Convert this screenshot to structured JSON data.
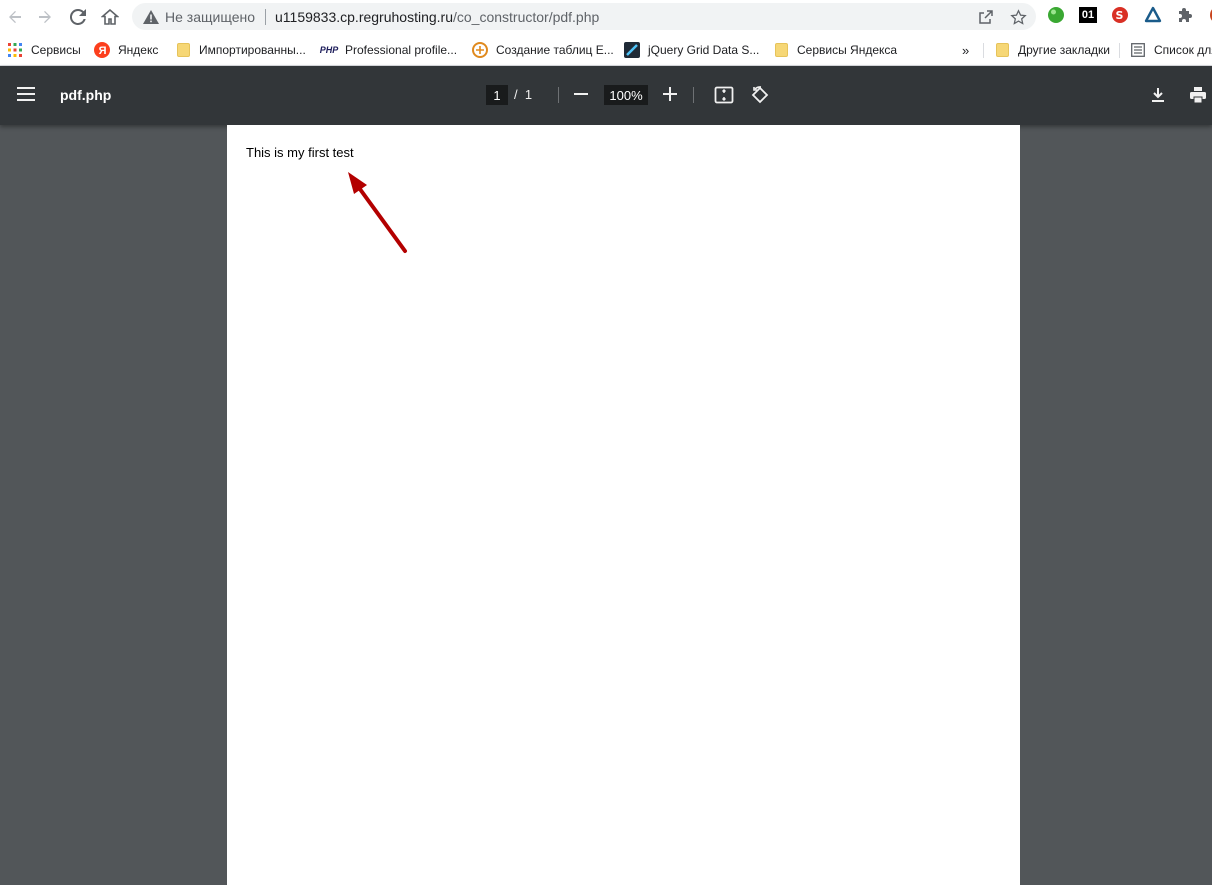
{
  "browser": {
    "security_label": "Не защищено",
    "url_host": "u1159833.cp.regruhosting.ru",
    "url_path": "/co_constructor/pdf.php"
  },
  "bookmarks": [
    {
      "label": "Сервисы",
      "icon": "apps-grid-icon"
    },
    {
      "label": "Яндекс",
      "icon": "yandex-icon"
    },
    {
      "label": "Импортированны...",
      "icon": "folder-icon"
    },
    {
      "label": "Professional profile...",
      "icon": "php-icon"
    },
    {
      "label": "Создание таблиц E...",
      "icon": "site-favicon"
    },
    {
      "label": "jQuery Grid Data S...",
      "icon": "site-favicon"
    },
    {
      "label": "Сервисы Яндекса",
      "icon": "folder-icon"
    }
  ],
  "bookmarks_overflow": "»",
  "other_bookmarks": "Другие закладки",
  "reading_list": "Список для",
  "viewer": {
    "title": "pdf.php",
    "current_page": "1",
    "page_separator": "/",
    "total_pages": "1",
    "zoom": "100%"
  },
  "document": {
    "text": "This is my first test"
  },
  "colors": {
    "toolbar_bg": "#323639",
    "viewer_bg": "#525659",
    "annotation_arrow": "#b30000"
  }
}
